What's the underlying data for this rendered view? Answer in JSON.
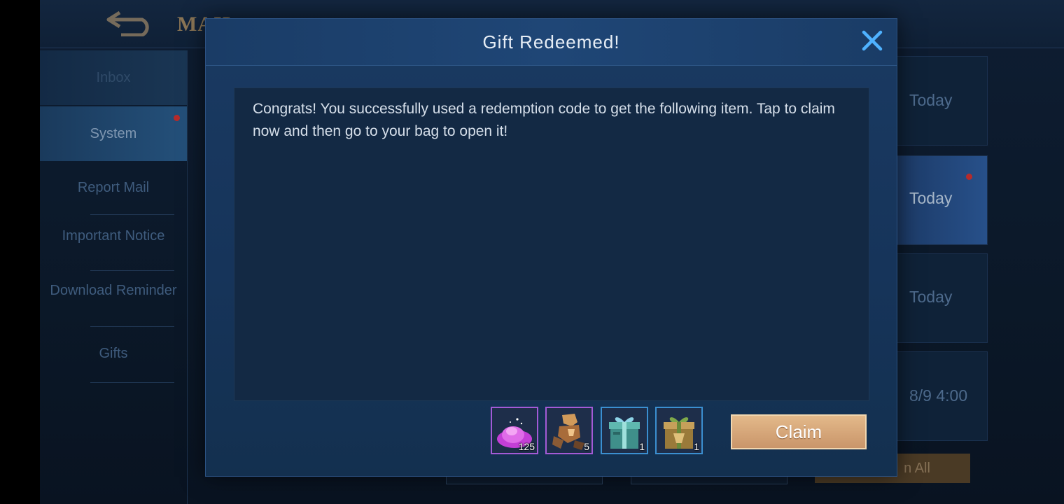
{
  "background": {
    "title": "MAIL",
    "sidebar": [
      {
        "label": "Inbox"
      },
      {
        "label": "System"
      },
      {
        "label": "Report Mail"
      },
      {
        "label": "Important Notice"
      },
      {
        "label": "Download Reminder"
      },
      {
        "label": "Gifts"
      }
    ],
    "mail_dates": [
      "Today",
      "Today",
      "Today",
      "8/9 4:00"
    ],
    "claim_all_label": "n All"
  },
  "modal": {
    "title": "Gift Redeemed!",
    "close_icon": "close-icon",
    "message": "Congrats! You successfully used a redemption code to get the following item. Tap to claim now and then go to your bag to open it!",
    "items": [
      {
        "icon": "pink-dust-icon",
        "count": "125",
        "rarity_color": "#a35ad6"
      },
      {
        "icon": "mech-fragment-icon",
        "count": "5",
        "rarity_color": "#a35ad6"
      },
      {
        "icon": "blue-gift-box-icon",
        "count": "1",
        "rarity_color": "#3b8fd0"
      },
      {
        "icon": "gold-gift-box-icon",
        "count": "1",
        "rarity_color": "#3b8fd0"
      }
    ],
    "claim_label": "Claim"
  },
  "colors": {
    "accent_gold": "#d6a878",
    "modal_blue": "#1a3a62",
    "notification_red": "#b62b2b"
  }
}
